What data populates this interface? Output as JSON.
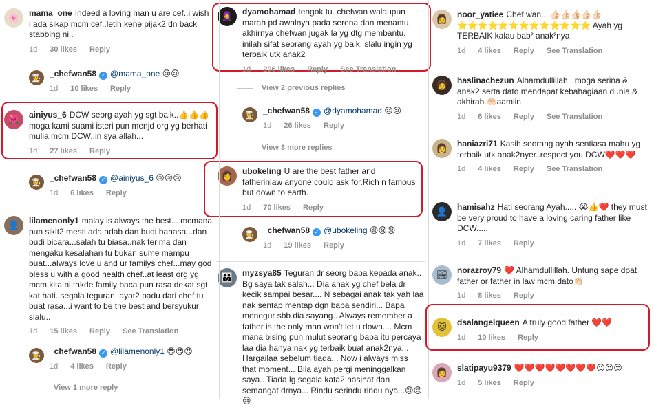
{
  "verified_glyph": "✓",
  "time_1d": "1d",
  "reply_label": "Reply",
  "see_translation": "See Translation",
  "reply_author": "_chefwan58",
  "col1": {
    "c1": {
      "user": "mama_one",
      "text": "Indeed a loving man u are cef..i wish i ada sikap mcm cef..letih kene pijak2 dn back stabbing ni..",
      "likes": "30 likes"
    },
    "r1": {
      "mention": "@mama_one",
      "text": "😢😢",
      "likes": "10 likes"
    },
    "c2": {
      "user": "ainiyus_6",
      "text": "DCW seorg ayah yg sgt baik..👍👍👍moga kami suami isteri pun menjd org yg berhati mulia mcm DCW..in sya allah...",
      "likes": "27 likes"
    },
    "r2": {
      "mention": "@ainiyus_6",
      "text": "😢😢😢",
      "likes": "6 likes"
    },
    "c3": {
      "user": "lilamenonly1",
      "text": "malay is always the best... mcmana pun sikit2 mesti ada adab dan budi bahasa...dan budi bicara...salah tu biasa..nak terima dan mengaku kesalahan tu bukan sume mampu buat...always love u and ur familys chef...may god bless u with a good health chef..at least org yg mcm kita ni takde family baca pun rasa dekat sgt kat hati..segala teguran..ayat2 padu dari chef tu buat rasa...i want to be the best and bersyukur slalu..",
      "likes": "15 likes"
    },
    "r3": {
      "mention": "@lilamenonly1",
      "text": "😍😍😍",
      "likes": "4 likes"
    },
    "more": "View 1 more reply"
  },
  "col2": {
    "c1": {
      "user": "dyamohamad",
      "text": "tengok tu. chefwan walaupun marah pd awalnya pada serena dan menantu. akhirnya chefwan jugak la yg dtg membantu. inilah sifat seorang ayah yg baik. slalu ingin yg terbaik utk anak2",
      "likes": "296 likes"
    },
    "prev": "View 2 previous replies",
    "r1": {
      "mention": "@dyamohamad",
      "text": "😢😢",
      "likes": "26 likes"
    },
    "more": "View 3 more replies",
    "c2": {
      "user": "ubokeling",
      "text": "U are the best father and fatherinlaw anyone could ask for.Rich n famous but down to earth.",
      "likes": "70 likes"
    },
    "r2": {
      "mention": "@ubokeling",
      "text": "😢😢😢",
      "likes": "19 likes"
    },
    "c3": {
      "user": "myzsya85",
      "text": "Teguran dr seorg bapa kepada anak.. Bg saya tak salah... Dia anak yg chef bela dr kecik sampai besar.... N sebagai anak tak yah laa nak sentap mentap dgn bapa sendiri... Bapa menegur sbb dia sayang.. Always remember a father is the only man won't let u down.... Mcm mana bising pun mulut seorang bapa itu percaya laa dia hanya nak yg terbaik buat anak2nya... Hargailaa sebelum tiada... Now i always miss that moment... Bila ayah pergi meninggalkan saya.. Tiada lg segala kata2 nasihat dan semangat drnya... Rindu serindu rindu nya...😢😢😢"
    }
  },
  "col3": {
    "c1": {
      "user": "noor_yatiee",
      "text": "Chef wan....👍🏻👍🏻👍🏻👍🏻👍🏻⭐⭐⭐⭐⭐⭐⭐⭐⭐⭐⭐⭐⭐ Ayah yg TERBAIK kalau bab² anak²nya",
      "likes": "4 likes"
    },
    "c2": {
      "user": "haslinachezun",
      "text": "Alhamdullillah.. moga serina & anak2 serta dato mendapat kebahagiaan dunia & akhirah 🤲🏻aamiin",
      "likes": "6 likes"
    },
    "c3": {
      "user": "haniazri71",
      "text": "Kasih seorang ayah sentiasa mahu yg terbaik utk anak2nyer..respect you DCW❤️❤️❤️",
      "likes": "4 likes"
    },
    "c4": {
      "user": "hamisahz",
      "text": "Hati seorang Ayah..... 😭👍❤️ they must be very proud to have a loving caring father like DCW.....",
      "likes": "7 likes"
    },
    "c5": {
      "user": "norazroy79",
      "text": "❤️ Alhamdullillah. Untung sape dpat father or father in law mcm dato👏🏻",
      "likes": "8 likes"
    },
    "c6": {
      "user": "dsalangelqueen",
      "text": "A truly good father ❤️❤️",
      "likes": "10 likes"
    },
    "c7": {
      "user": "slatipayu9379",
      "text": "❤️❤️❤️❤️❤️❤️❤️❤️😍😍😍",
      "likes": "5 likes"
    }
  },
  "colors": {
    "highlight": "#d11a2a",
    "meta": "#8e8e8e",
    "verified": "#3897f0"
  }
}
